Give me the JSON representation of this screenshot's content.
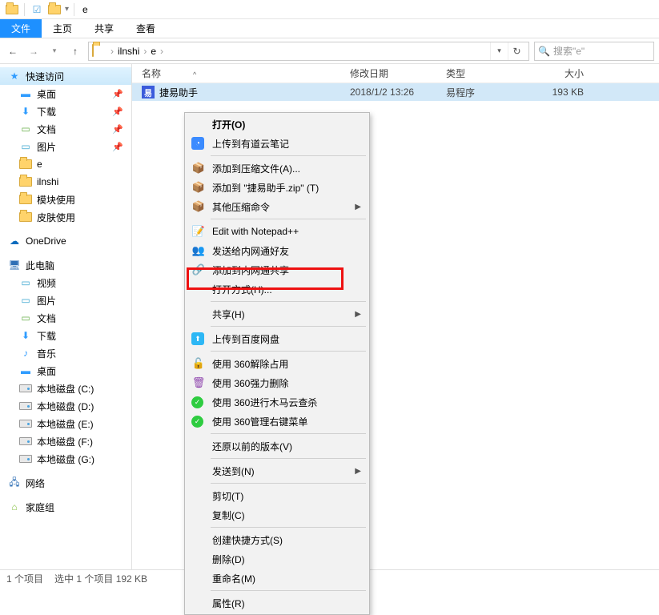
{
  "titlebar": {
    "title": "e"
  },
  "ribbon": {
    "file": "文件",
    "home": "主页",
    "share": "共享",
    "view": "查看"
  },
  "breadcrumb": {
    "root_sep": "›",
    "items": [
      "ilnshi",
      "e"
    ]
  },
  "search": {
    "placeholder": "搜索\"e\""
  },
  "columns": {
    "name": "名称",
    "date": "修改日期",
    "type": "类型",
    "size": "大小"
  },
  "file": {
    "name": "捷易助手",
    "date": "2018/1/2 13:26",
    "type": "易程序",
    "size": "193 KB"
  },
  "sidebar": {
    "quick": "快速访问",
    "desktop": "桌面",
    "downloads": "下载",
    "documents": "文档",
    "pictures": "图片",
    "e": "e",
    "ilnshi": "ilnshi",
    "mod": "模块使用",
    "skin": "皮肤使用",
    "onedrive": "OneDrive",
    "thispc": "此电脑",
    "video": "视频",
    "pic2": "图片",
    "doc2": "文档",
    "dl2": "下载",
    "music": "音乐",
    "desk2": "桌面",
    "c": "本地磁盘 (C:)",
    "d": "本地磁盘 (D:)",
    "e2": "本地磁盘 (E:)",
    "f": "本地磁盘 (F:)",
    "g": "本地磁盘 (G:)",
    "network": "网络",
    "homegroup": "家庭组"
  },
  "context": {
    "open": "打开(O)",
    "youdao": "上传到有道云笔记",
    "addarchive": "添加到压缩文件(A)...",
    "addzip": "添加到 \"捷易助手.zip\" (T)",
    "othercomp": "其他压缩命令",
    "notepad": "Edit with Notepad++",
    "sendfriend": "发送给内网通好友",
    "addintranet": "添加到内网通共享",
    "openwith": "打开方式(H)...",
    "share": "共享(H)",
    "baidu": "上传到百度网盘",
    "unlock360": "使用 360解除占用",
    "delete360": "使用 360强力删除",
    "scan360": "使用 360进行木马云查杀",
    "rmenu360": "使用 360管理右键菜单",
    "restore": "还原以前的版本(V)",
    "sendto": "发送到(N)",
    "cut": "剪切(T)",
    "copy": "复制(C)",
    "shortcut": "创建快捷方式(S)",
    "delete": "删除(D)",
    "rename": "重命名(M)",
    "props": "属性(R)"
  },
  "status": {
    "count": "1 个项目",
    "selected": "选中 1 个项目 192 KB"
  }
}
